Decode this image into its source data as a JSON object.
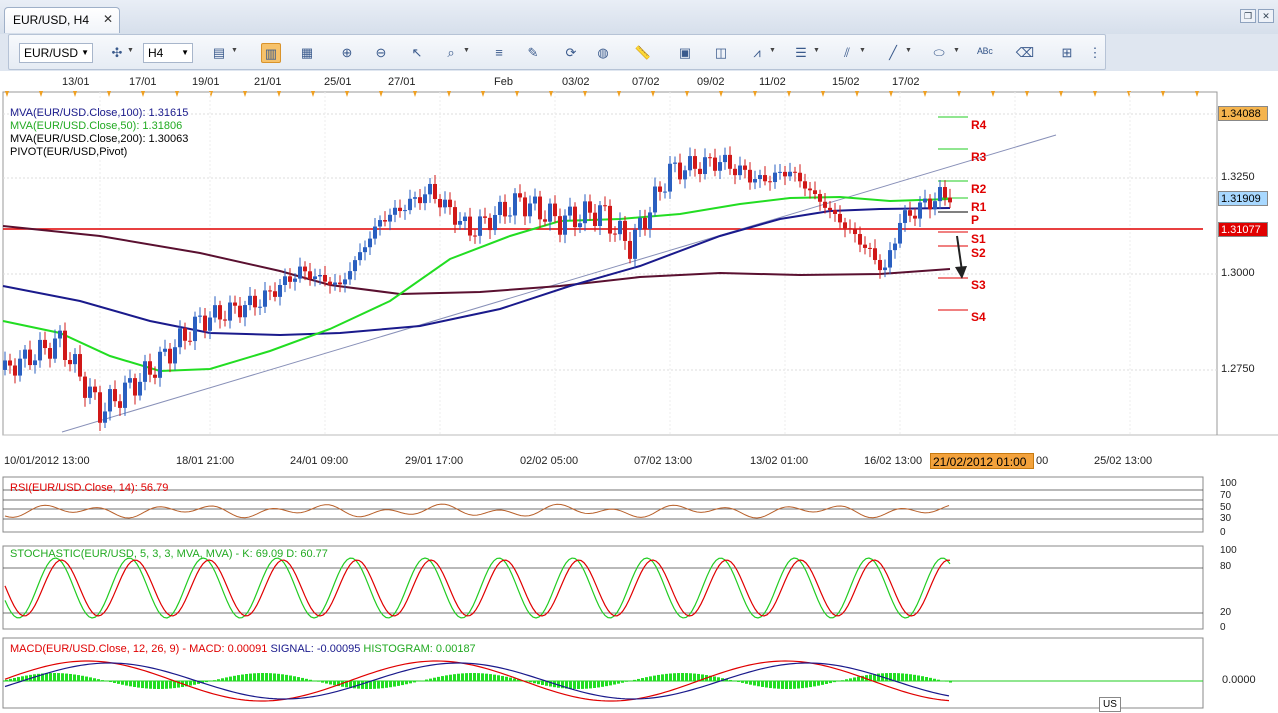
{
  "window": {
    "tab_title": "EUR/USD, H4",
    "tab_close": "✕"
  },
  "toolbar": {
    "symbol": "EUR/USD",
    "timeframe": "H4"
  },
  "top_dates": [
    "13/01",
    "17/01",
    "19/01",
    "21/01",
    "25/01",
    "27/01",
    "Feb",
    "03/02",
    "07/02",
    "09/02",
    "11/02",
    "15/02",
    "17/02"
  ],
  "indicators": {
    "mva100": "MVA(EUR/USD.Close,100): 1.31615",
    "mva50": "MVA(EUR/USD.Close,50): 1.31806",
    "mva200": "MVA(EUR/USD.Close,200): 1.30063",
    "pivot": "PIVOT(EUR/USD,Pivot)"
  },
  "price_axis": {
    "ticks": [
      "1.3250",
      "1.3000",
      "1.2750"
    ],
    "box_top": "1.34088",
    "box_current": "1.31909",
    "box_pivot": "1.31077"
  },
  "pivot_levels": [
    "R4",
    "R3",
    "R2",
    "R1",
    "P",
    "S1",
    "S2",
    "S3",
    "S4"
  ],
  "time_axis": [
    "10/01/2012 13:00",
    "18/01 21:00",
    "24/01 09:00",
    "29/01 17:00",
    "02/02 05:00",
    "07/02 13:00",
    "13/02 01:00",
    "16/02 13:00",
    "00",
    "25/02 13:00"
  ],
  "time_tag": "21/02/2012 01:00",
  "rsi": {
    "label": "RSI(EUR/USD.Close, 14): 56.79",
    "ticks": [
      "100",
      "70",
      "50",
      "30",
      "0"
    ]
  },
  "stoch": {
    "label": "STOCHASTIC(EUR/USD, 5, 3, 3, MVA, MVA) -  K: 69.09  D: 60.77",
    "ticks": [
      "100",
      "80",
      "20",
      "0"
    ]
  },
  "macd": {
    "label_name": "MACD(EUR/USD.Close, 12, 26, 9) -",
    "label_macd": "MACD: 0.00091",
    "label_signal": "SIGNAL: -0.00095",
    "label_hist": "HISTOGRAM: 0.00187",
    "tick": "0.0000"
  },
  "status": {
    "locale": "US"
  },
  "colors": {
    "mva50": "#22dd22",
    "mva100": "#1a1a8c",
    "mva200": "#5a1030",
    "pivot": "#e00000",
    "bull": "#2a5fc0",
    "bear": "#d01818"
  },
  "icons": [
    "crosshair-icon",
    "bars-icon",
    "candles-icon",
    "line-icon",
    "zoom-icon",
    "indicator-icon",
    "ruler-icon",
    "text-icon",
    "trendline-icon",
    "eraser-icon",
    "objects-icon"
  ]
}
